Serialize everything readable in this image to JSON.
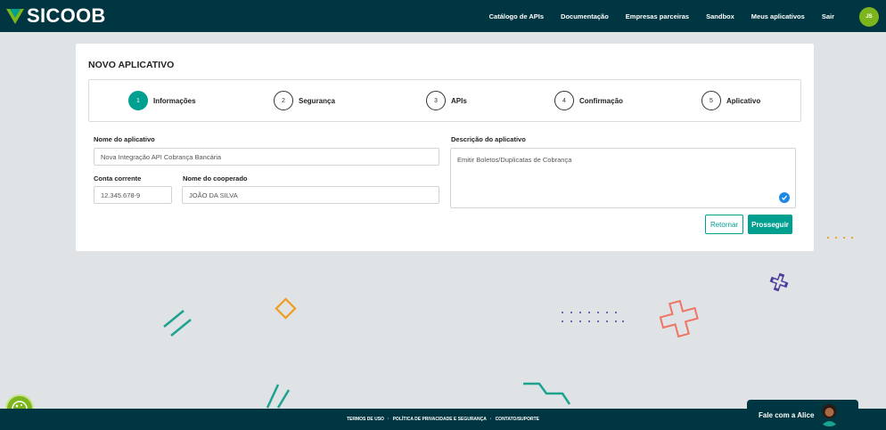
{
  "brand": {
    "name": "SICOOB",
    "logo_icon": "sicoob-v-logo"
  },
  "nav": {
    "items": [
      {
        "label": "Catálogo de APIs"
      },
      {
        "label": "Documentação"
      },
      {
        "label": "Empresas parceiras"
      },
      {
        "label": "Sandbox"
      },
      {
        "label": "Meus aplicativos"
      },
      {
        "label": "Sair"
      }
    ],
    "avatar_initials": "JS"
  },
  "page": {
    "title": "NOVO APLICATIVO"
  },
  "stepper": {
    "steps": [
      {
        "number": "1",
        "label": "Informações",
        "active": true
      },
      {
        "number": "2",
        "label": "Segurança",
        "active": false
      },
      {
        "number": "3",
        "label": "APIs",
        "active": false
      },
      {
        "number": "4",
        "label": "Confirmação",
        "active": false
      },
      {
        "number": "5",
        "label": "Aplicativo",
        "active": false
      }
    ]
  },
  "form": {
    "app_name": {
      "label": "Nome do aplicativo",
      "value": "Nova Integração API Cobrança Bancária"
    },
    "account": {
      "label": "Conta corrente",
      "value": "12.345.678-9"
    },
    "member_name": {
      "label": "Nome do cooperado",
      "value": "JOÃO DA SILVA"
    },
    "description": {
      "label": "Descrição do aplicativo",
      "value": "Emitir Boletos/Duplicatas de Cobrança"
    }
  },
  "actions": {
    "back_label": "Retornar",
    "next_label": "Prosseguir"
  },
  "footer": {
    "links": [
      "TERMOS DE USO",
      "POLÍTICA DE PRIVACIDADE E SEGURANÇA",
      "CONTATO/SUPORTE"
    ],
    "separator": "·"
  },
  "chat": {
    "label": "Fale com a Alice"
  },
  "colors": {
    "header_bg": "#003641",
    "accent": "#00a091",
    "brand_green": "#7db61c",
    "background": "#dfe3e6"
  }
}
